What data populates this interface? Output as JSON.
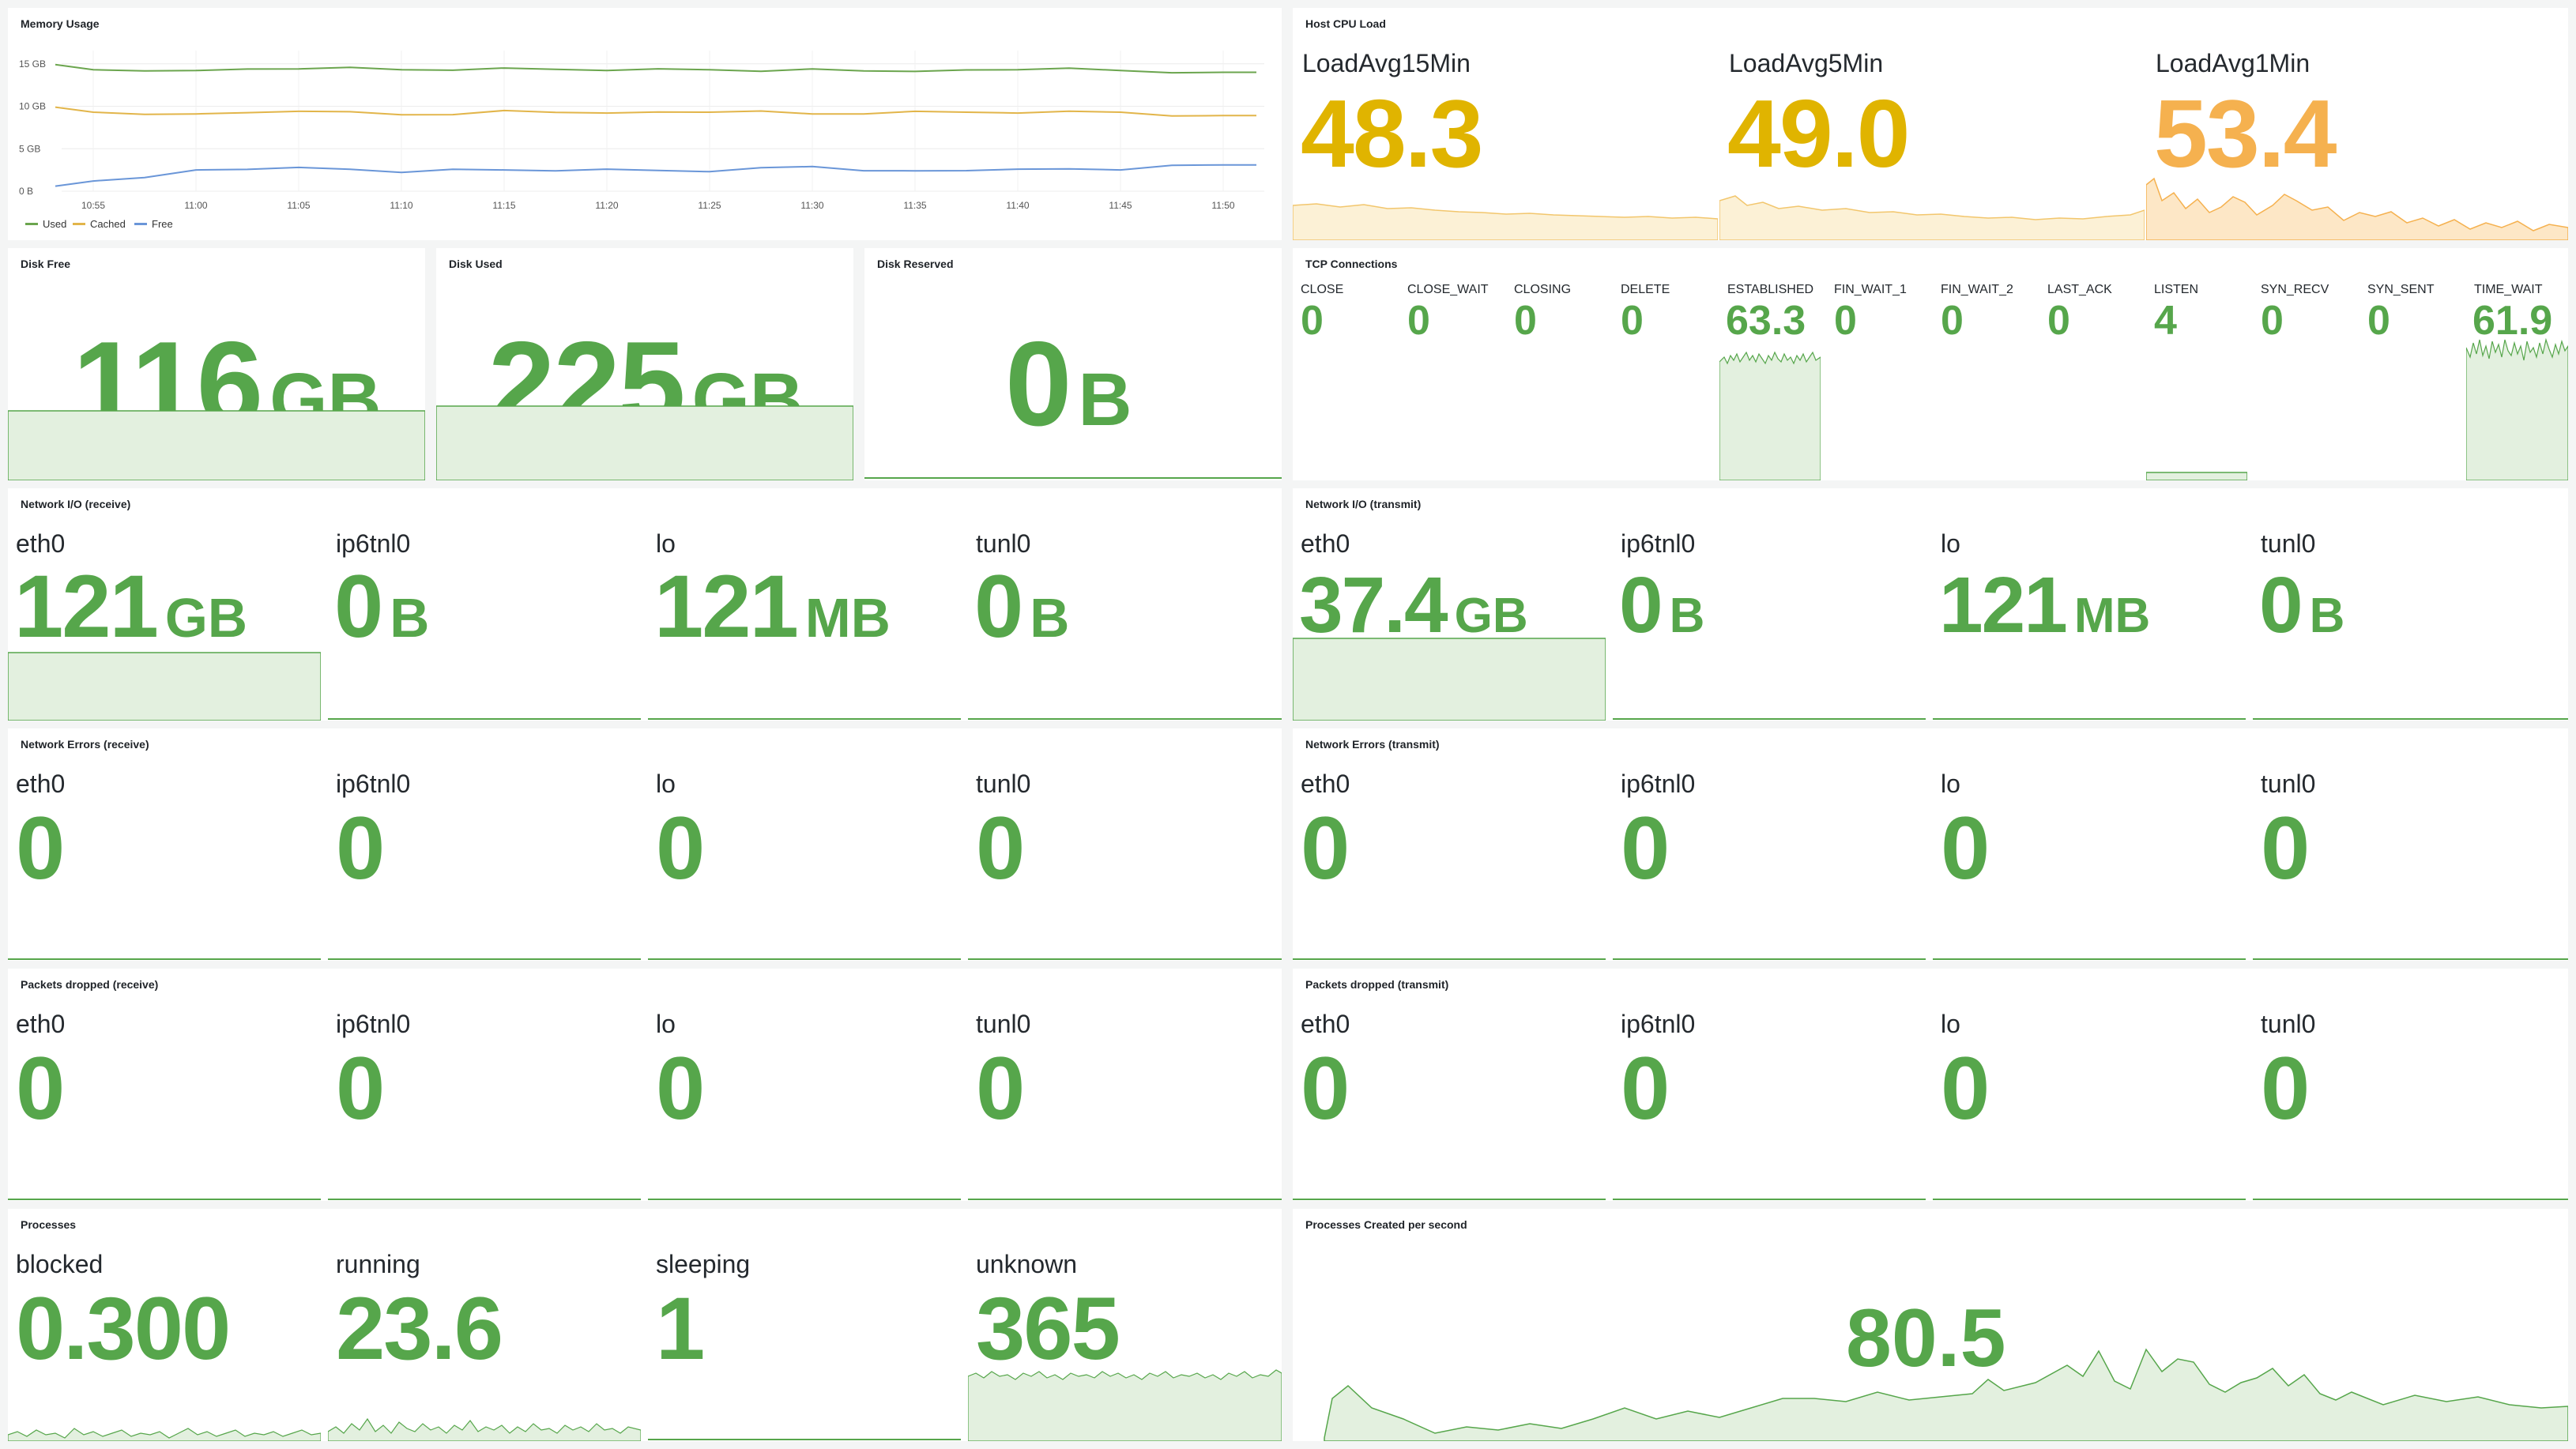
{
  "colors": {
    "green": "#56a64b",
    "green_fill": "#e3f0df",
    "yellow": "#e0b400",
    "orange": "#f5b14f",
    "yellow_fill": "#fcf1d6",
    "orange_fill": "#fde7c6",
    "mem_used": "#6ba54e",
    "mem_cached": "#e2b54a",
    "mem_free": "#6a96d8"
  },
  "memory": {
    "title": "Memory Usage",
    "y_ticks": [
      "15 GB",
      "10 GB",
      "5 GB",
      "0 B"
    ],
    "x_ticks": [
      "10:55",
      "11:00",
      "11:05",
      "11:10",
      "11:15",
      "11:20",
      "11:25",
      "11:30",
      "11:35",
      "11:40",
      "11:45",
      "11:50"
    ],
    "legend": [
      {
        "name": "Used",
        "color": "#6ba54e"
      },
      {
        "name": "Cached",
        "color": "#e2b54a"
      },
      {
        "name": "Free",
        "color": "#6a96d8"
      }
    ]
  },
  "chart_data": {
    "type": "line",
    "title": "Memory Usage",
    "x": [
      "10:55",
      "11:00",
      "11:05",
      "11:10",
      "11:15",
      "11:20",
      "11:25",
      "11:30",
      "11:35",
      "11:40",
      "11:45",
      "11:50"
    ],
    "ylim": [
      0,
      16
    ],
    "series": [
      {
        "name": "Used",
        "values": [
          14.3,
          14.2,
          14.4,
          14.3,
          14.5,
          14.2,
          14.3,
          14.4,
          14.1,
          14.3,
          14.2,
          14.0
        ]
      },
      {
        "name": "Cached",
        "values": [
          9.3,
          9.1,
          9.4,
          9.0,
          9.5,
          9.2,
          9.3,
          9.1,
          9.4,
          9.2,
          9.3,
          8.9
        ]
      },
      {
        "name": "Free",
        "values": [
          1.2,
          2.5,
          2.8,
          2.2,
          2.5,
          2.6,
          2.3,
          2.9,
          2.4,
          2.6,
          2.5,
          3.1
        ]
      }
    ]
  },
  "cpu": {
    "title": "Host CPU Load",
    "items": [
      {
        "label": "LoadAvg15Min",
        "value": "48.3"
      },
      {
        "label": "LoadAvg5Min",
        "value": "49.0"
      },
      {
        "label": "LoadAvg1Min",
        "value": "53.4"
      }
    ]
  },
  "disk": {
    "free": {
      "title": "Disk Free",
      "value": "116",
      "unit": "GB"
    },
    "used": {
      "title": "Disk Used",
      "value": "225",
      "unit": "GB"
    },
    "reserved": {
      "title": "Disk Reserved",
      "value": "0",
      "unit": "B"
    }
  },
  "tcp": {
    "title": "TCP Connections",
    "items": [
      {
        "label": "CLOSE",
        "value": "0"
      },
      {
        "label": "CLOSE_WAIT",
        "value": "0"
      },
      {
        "label": "CLOSING",
        "value": "0"
      },
      {
        "label": "DELETE",
        "value": "0"
      },
      {
        "label": "ESTABLISHED",
        "value": "63.3"
      },
      {
        "label": "FIN_WAIT_1",
        "value": "0"
      },
      {
        "label": "FIN_WAIT_2",
        "value": "0"
      },
      {
        "label": "LAST_ACK",
        "value": "0"
      },
      {
        "label": "LISTEN",
        "value": "4"
      },
      {
        "label": "SYN_RECV",
        "value": "0"
      },
      {
        "label": "SYN_SENT",
        "value": "0"
      },
      {
        "label": "TIME_WAIT",
        "value": "61.9"
      }
    ]
  },
  "net_rx": {
    "title": "Network I/O (receive)",
    "items": [
      {
        "label": "eth0",
        "value": "121",
        "unit": "GB"
      },
      {
        "label": "ip6tnl0",
        "value": "0",
        "unit": "B"
      },
      {
        "label": "lo",
        "value": "121",
        "unit": "MB"
      },
      {
        "label": "tunl0",
        "value": "0",
        "unit": "B"
      }
    ]
  },
  "net_tx": {
    "title": "Network I/O (transmit)",
    "items": [
      {
        "label": "eth0",
        "value": "37.4",
        "unit": "GB"
      },
      {
        "label": "ip6tnl0",
        "value": "0",
        "unit": "B"
      },
      {
        "label": "lo",
        "value": "121",
        "unit": "MB"
      },
      {
        "label": "tunl0",
        "value": "0",
        "unit": "B"
      }
    ]
  },
  "err_rx": {
    "title": "Network Errors (receive)",
    "items": [
      {
        "label": "eth0",
        "value": "0"
      },
      {
        "label": "ip6tnl0",
        "value": "0"
      },
      {
        "label": "lo",
        "value": "0"
      },
      {
        "label": "tunl0",
        "value": "0"
      }
    ]
  },
  "err_tx": {
    "title": "Network Errors (transmit)",
    "items": [
      {
        "label": "eth0",
        "value": "0"
      },
      {
        "label": "ip6tnl0",
        "value": "0"
      },
      {
        "label": "lo",
        "value": "0"
      },
      {
        "label": "tunl0",
        "value": "0"
      }
    ]
  },
  "drop_rx": {
    "title": "Packets dropped (receive)",
    "items": [
      {
        "label": "eth0",
        "value": "0"
      },
      {
        "label": "ip6tnl0",
        "value": "0"
      },
      {
        "label": "lo",
        "value": "0"
      },
      {
        "label": "tunl0",
        "value": "0"
      }
    ]
  },
  "drop_tx": {
    "title": "Packets dropped (transmit)",
    "items": [
      {
        "label": "eth0",
        "value": "0"
      },
      {
        "label": "ip6tnl0",
        "value": "0"
      },
      {
        "label": "lo",
        "value": "0"
      },
      {
        "label": "tunl0",
        "value": "0"
      }
    ]
  },
  "procs": {
    "title": "Processes",
    "items": [
      {
        "label": "blocked",
        "value": "0.300"
      },
      {
        "label": "running",
        "value": "23.6"
      },
      {
        "label": "sleeping",
        "value": "1"
      },
      {
        "label": "unknown",
        "value": "365"
      }
    ]
  },
  "procs_created": {
    "title": "Processes Created per second",
    "value": "80.5"
  }
}
